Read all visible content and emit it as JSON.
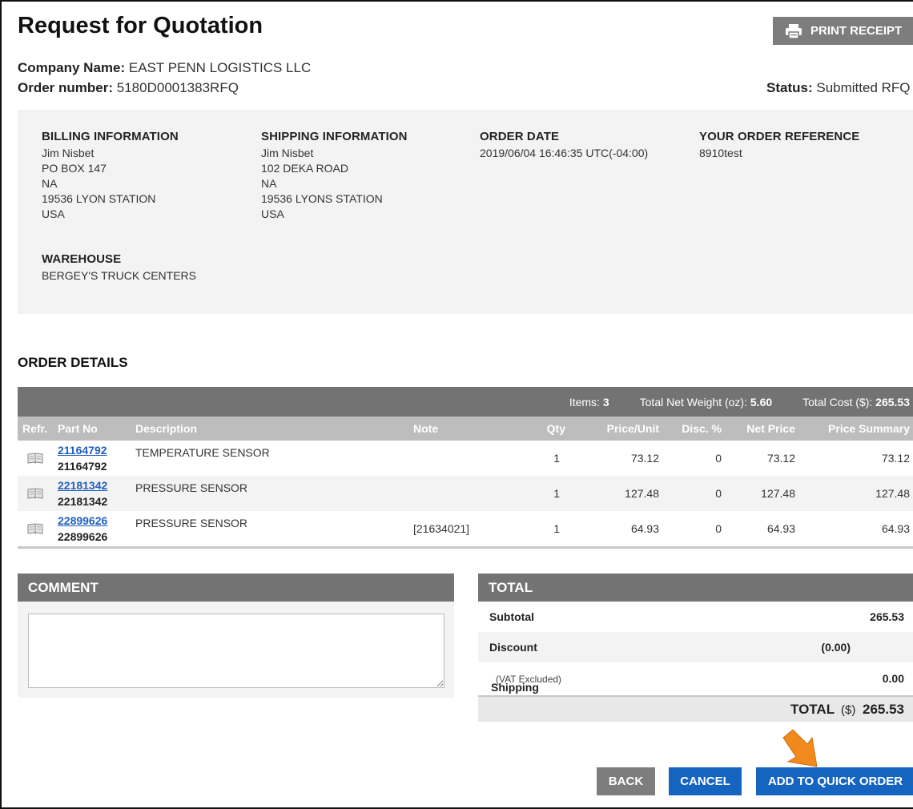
{
  "header": {
    "title": "Request for Quotation",
    "print_label": "PRINT RECEIPT"
  },
  "order_meta": {
    "company_label": "Company Name:",
    "company_value": "EAST PENN LOGISTICS LLC",
    "order_label": "Order number:",
    "order_value": "5180D0001383RFQ",
    "status_label": "Status:",
    "status_value": "Submitted RFQ"
  },
  "info": {
    "billing": {
      "title": "BILLING INFORMATION",
      "lines": [
        "Jim Nisbet",
        "PO BOX 147",
        "NA",
        "19536 LYON STATION",
        "USA"
      ]
    },
    "shipping": {
      "title": "SHIPPING INFORMATION",
      "lines": [
        "Jim Nisbet",
        "102 DEKA ROAD",
        "NA",
        "19536 LYONS STATION",
        "USA"
      ]
    },
    "order_date": {
      "title": "ORDER DATE",
      "value": "2019/06/04 16:46:35 UTC(-04:00)"
    },
    "reference": {
      "title": "YOUR ORDER REFERENCE",
      "value": "8910test"
    },
    "warehouse": {
      "title": "WAREHOUSE",
      "value": "BERGEY'S TRUCK CENTERS"
    }
  },
  "order_details": {
    "title": "ORDER DETAILS",
    "summary": {
      "items_label": "Items:",
      "items_value": "3",
      "weight_label": "Total Net Weight (oz):",
      "weight_value": "5.60",
      "cost_label": "Total Cost ($):",
      "cost_value": "265.53"
    },
    "columns": [
      "Refr.",
      "Part No",
      "Description",
      "Note",
      "Qty",
      "Price/Unit",
      "Disc. %",
      "Net Price",
      "Price Summary"
    ],
    "rows": [
      {
        "part_link": "21164792",
        "part_no": "21164792",
        "description": "TEMPERATURE SENSOR",
        "note": "",
        "qty": "1",
        "price_unit": "73.12",
        "disc": "0",
        "net_price": "73.12",
        "price_summary": "73.12"
      },
      {
        "part_link": "22181342",
        "part_no": "22181342",
        "description": "PRESSURE SENSOR",
        "note": "",
        "qty": "1",
        "price_unit": "127.48",
        "disc": "0",
        "net_price": "127.48",
        "price_summary": "127.48"
      },
      {
        "part_link": "22899626",
        "part_no": "22899626",
        "description": "PRESSURE SENSOR",
        "note": "[21634021]",
        "qty": "1",
        "price_unit": "64.93",
        "disc": "0",
        "net_price": "64.93",
        "price_summary": "64.93"
      }
    ]
  },
  "comment": {
    "title": "COMMENT",
    "value": ""
  },
  "totals": {
    "title": "TOTAL",
    "subtotal_label": "Subtotal",
    "subtotal_value": "265.53",
    "discount_label": "Discount",
    "discount_value": "(0.00)",
    "shipping_label": "Shipping",
    "shipping_note": "(VAT Excluded)",
    "shipping_value": "0.00",
    "total_label": "TOTAL",
    "total_currency": "($)",
    "total_value": "265.53"
  },
  "actions": {
    "back_label": "BACK",
    "cancel_label": "CANCEL",
    "quick_order_label": "ADD TO QUICK ORDER"
  },
  "colors": {
    "accent_blue": "#1565c0",
    "header_gray": "#737373",
    "panel_gray": "#f3f3f3",
    "pointer_orange": "#f08a1c"
  }
}
